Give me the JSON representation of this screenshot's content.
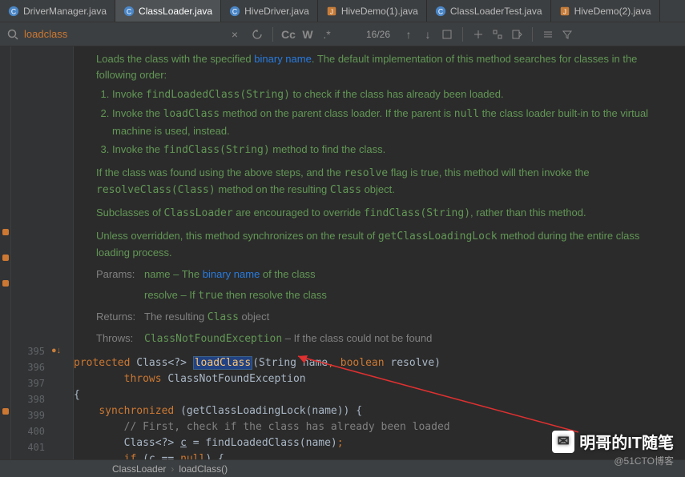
{
  "tabs": [
    {
      "label": "DriverManager.java",
      "icon": "c"
    },
    {
      "label": "ClassLoader.java",
      "icon": "c",
      "active": true
    },
    {
      "label": "HiveDriver.java",
      "icon": "c"
    },
    {
      "label": "HiveDemo(1).java",
      "icon": "j"
    },
    {
      "label": "ClassLoaderTest.java",
      "icon": "c"
    },
    {
      "label": "HiveDemo(2).java",
      "icon": "j"
    }
  ],
  "find": {
    "query": "loadclass",
    "count": "16/26"
  },
  "doc": {
    "intro_a": "Loads the class with the specified ",
    "intro_link": "binary name",
    "intro_b": ". The default implementation of this method searches for classes in the following order:",
    "li1_a": "Invoke ",
    "li1_link": "findLoadedClass(String)",
    "li1_b": " to check if the class has already been loaded.",
    "li2_a": "Invoke the ",
    "li2_m": "loadClass",
    "li2_b": " method on the parent class loader. If the parent is ",
    "li2_c": "null",
    "li2_d": " the class loader built-in to the virtual machine is used, instead.",
    "li3_a": "Invoke the ",
    "li3_link": "findClass(String)",
    "li3_b": " method to find the class.",
    "p2_a": "If the class was found using the above steps, and the ",
    "p2_b": "resolve",
    "p2_c": " flag is true, this method will then invoke the ",
    "p2_link": "resolveClass(Class)",
    "p2_d": " method on the resulting ",
    "p2_e": "Class",
    "p2_f": " object.",
    "p3_a": "Subclasses of ",
    "p3_b": "ClassLoader",
    "p3_c": " are encouraged to override ",
    "p3_link": "findClass(String)",
    "p3_d": ", rather than this method.",
    "p4_a": "Unless overridden, this method synchronizes on the result of ",
    "p4_link": "getClassLoadingLock",
    "p4_b": " method during the entire class loading process.",
    "params_lbl": "Params:",
    "params_a": "name – The ",
    "params_link": "binary name",
    "params_b": " of the class",
    "params2": "resolve – If ",
    "params2b": "true",
    "params2c": " then resolve the class",
    "returns_lbl": "Returns:",
    "returns": "The resulting ",
    "returns_b": "Class",
    "returns_c": " object",
    "throws_lbl": "Throws:",
    "throws_link": "ClassNotFoundException",
    "throws_b": " – If the class could not be found"
  },
  "lines": [
    "395",
    "396",
    "397",
    "398",
    "399",
    "400",
    "401"
  ],
  "code": {
    "l395": {
      "kw": "protected",
      "sp": " ",
      "t": "Class",
      "g": "<?>",
      "sp2": " ",
      "m": "loadClass",
      "p": "(String name",
      "c": ",",
      "sp3": " ",
      "kw2": "boolean",
      "sp4": " ",
      "r": "resolve)"
    },
    "l396": {
      "ind": "        ",
      "kw": "throws",
      "sp": " ",
      "t": "ClassNotFoundException"
    },
    "l397": "{",
    "l398": {
      "ind": "    ",
      "kw": "synchronized",
      "sp": " ",
      "r": "(getClassLoadingLock(name)) {"
    },
    "l399": "        // First, check if the class has already been loaded",
    "l400": {
      "ind": "        ",
      "t": "Class<?> ",
      "v": "c",
      "sp": " = findLoadedClass(name)",
      "sc": ";"
    },
    "l401": {
      "ind": "        ",
      "kw": "if",
      "sp": " (c ",
      "op": "==",
      "sp2": " ",
      "kw2": "null",
      "r": ") {"
    }
  },
  "breadcrumb": {
    "a": "ClassLoader",
    "b": "loadClass()"
  },
  "watermark": {
    "text": "明哥的IT随笔",
    "sub": "@51CTO博客"
  }
}
